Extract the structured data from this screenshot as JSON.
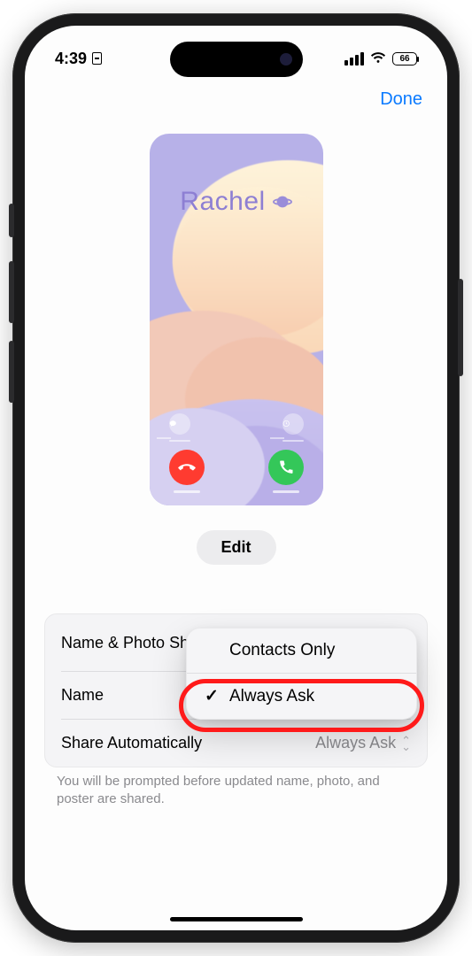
{
  "status": {
    "time": "4:39",
    "battery": "66"
  },
  "nav": {
    "done": "Done"
  },
  "poster": {
    "name": "Rachel"
  },
  "edit": {
    "label": "Edit"
  },
  "list": {
    "namePhoto": "Name & Photo Sharing",
    "name": "Name",
    "shareAuto": "Share Automatically",
    "shareValue": "Always Ask"
  },
  "popup": {
    "opt1": "Contacts Only",
    "opt2": "Always Ask"
  },
  "help": "You will be prompted before updated name, photo, and poster are shared."
}
